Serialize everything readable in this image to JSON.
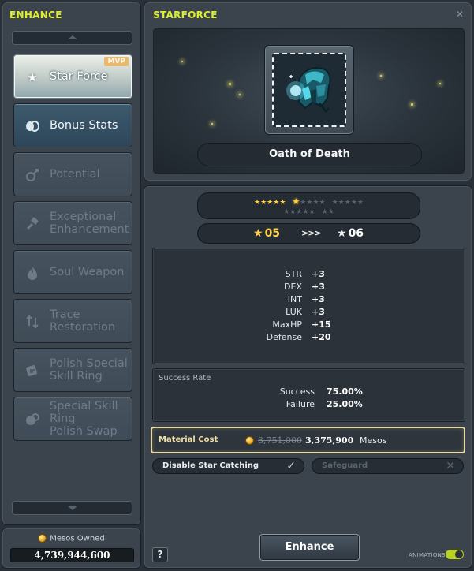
{
  "enhance_panel": {
    "title": "ENHANCE",
    "items": [
      {
        "label": "Star Force",
        "icon": "star-icon",
        "state": "active",
        "badge": "MVP"
      },
      {
        "label": "Bonus Stats",
        "icon": "bonus-stats-icon",
        "state": "enabled"
      },
      {
        "label": "Potential",
        "icon": "potential-icon",
        "state": "disabled"
      },
      {
        "label": "Exceptional\nEnhancement",
        "icon": "hammer-icon",
        "state": "disabled"
      },
      {
        "label": "Soul Weapon",
        "icon": "flame-icon",
        "state": "disabled"
      },
      {
        "label": "Trace\nRestoration",
        "icon": "trace-icon",
        "state": "disabled"
      },
      {
        "label": "Polish Special\nSkill Ring",
        "icon": "polish-icon",
        "state": "disabled"
      },
      {
        "label": "Special Skill Ring\nPolish Swap",
        "icon": "swap-icon",
        "state": "disabled"
      }
    ]
  },
  "mesos_owned": {
    "label": "Mesos Owned",
    "value": "4,739,944,600"
  },
  "starforce": {
    "title": "STARFORCE",
    "item_name": "Oath of Death",
    "stars": {
      "current": 5,
      "max": 22
    },
    "level_from": "05",
    "level_arrows": ">>>",
    "level_to": "06",
    "stats": [
      {
        "name": "STR",
        "value": "+3"
      },
      {
        "name": "DEX",
        "value": "+3"
      },
      {
        "name": "INT",
        "value": "+3"
      },
      {
        "name": "LUK",
        "value": "+3"
      },
      {
        "name": "MaxHP",
        "value": "+15"
      },
      {
        "name": "Defense",
        "value": "+20"
      }
    ],
    "success_rate": {
      "title": "Success Rate",
      "success_label": "Success",
      "success_value": "75.00%",
      "failure_label": "Failure",
      "failure_value": "25.00%"
    },
    "material_cost": {
      "label": "Material Cost",
      "original": "3,751,000",
      "discounted": "3,375,900",
      "unit": "Mesos"
    },
    "disable_star_catching": {
      "label": "Disable Star Catching",
      "checked": true
    },
    "safeguard": {
      "label": "Safeguard",
      "enabled": false
    },
    "help_label": "?",
    "enhance_label": "Enhance",
    "animations_label": "ANIMATIONS",
    "animations_on": true
  },
  "colors": {
    "title_accent": "#ddee2f",
    "star_on": "#ffd33c",
    "mvp_badge": "#e9b96d",
    "cost_border": "#e6d9a4",
    "toggle_on": "#b8d224"
  }
}
